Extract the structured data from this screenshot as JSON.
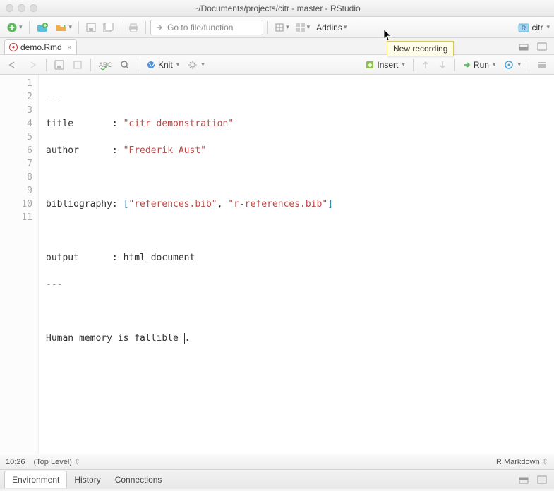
{
  "window": {
    "title": "~/Documents/projects/citr - master - RStudio"
  },
  "toolbar": {
    "goto_placeholder": "Go to file/function",
    "addins_label": "Addins",
    "project_name": "citr"
  },
  "tab": {
    "filename": "demo.Rmd"
  },
  "editorbar": {
    "knit_label": "Knit",
    "insert_label": "Insert",
    "run_label": "Run"
  },
  "code": {
    "lines": [
      "1",
      "2",
      "3",
      "4",
      "5",
      "6",
      "7",
      "8",
      "9",
      "10",
      "11"
    ],
    "l1": "---",
    "l2_key": "title       ",
    "l2_colon": ": ",
    "l2_val": "\"citr demonstration\"",
    "l3_key": "author      ",
    "l3_colon": ": ",
    "l3_val": "\"Frederik Aust\"",
    "l5_key": "bibliography",
    "l5_colon": ": ",
    "l5_b1": "[",
    "l5_v1": "\"references.bib\"",
    "l5_c": ", ",
    "l5_v2": "\"r-references.bib\"",
    "l5_b2": "]",
    "l7_key": "output      ",
    "l7_colon": ": ",
    "l7_val": "html_document",
    "l8": "---",
    "l10": "Human memory is fallible ",
    "l10_dot": "."
  },
  "status": {
    "pos": "10:26",
    "scope": "(Top Level)",
    "mode": "R Markdown"
  },
  "panes": {
    "env": "Environment",
    "hist": "History",
    "conn": "Connections"
  },
  "tooltip": {
    "text": "New recording"
  }
}
